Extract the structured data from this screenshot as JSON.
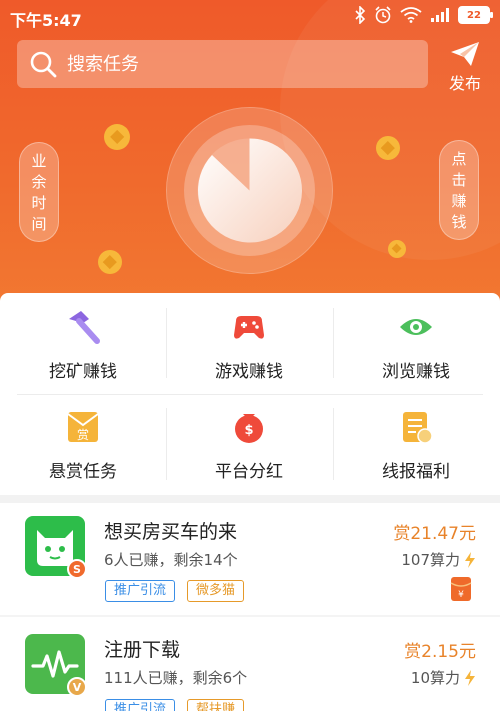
{
  "status": {
    "time": "下午5:47",
    "battery": "22"
  },
  "search": {
    "placeholder": "搜索任务"
  },
  "header": {
    "publish_label": "发布"
  },
  "side": {
    "left_label": "业余时间",
    "right_label": "点击赚钱"
  },
  "grid": {
    "items": [
      {
        "label": "挖矿赚钱",
        "icon": "hammer-icon"
      },
      {
        "label": "游戏赚钱",
        "icon": "gamepad-icon"
      },
      {
        "label": "浏览赚钱",
        "icon": "eye-icon"
      },
      {
        "label": "悬赏任务",
        "icon": "reward-envelope-icon"
      },
      {
        "label": "平台分红",
        "icon": "money-bag-icon"
      },
      {
        "label": "线报福利",
        "icon": "clipboard-icon"
      }
    ]
  },
  "tasks": [
    {
      "title": "想买房买车的来",
      "meta": "6人已赚，剩余14个",
      "reward": "赏21.47元",
      "power": "107算力",
      "badge": "S",
      "tags": [
        "推广引流",
        "微多猫"
      ]
    },
    {
      "title": "注册下载",
      "meta": "111人已赚，剩余6个",
      "reward": "赏2.15元",
      "power": "10算力",
      "badge": "V",
      "tags": [
        "推广引流",
        "帮扶赚"
      ]
    }
  ],
  "colors": {
    "brand": "#ef5a2a",
    "reward": "#e8832a",
    "tag_blue": "#3a8ee6",
    "tag_orange": "#e69a2a"
  }
}
